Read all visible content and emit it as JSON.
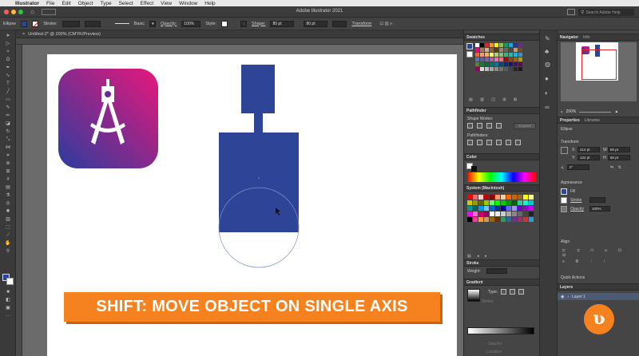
{
  "menubar": {
    "apple": "",
    "app": "Illustrator",
    "items": [
      "File",
      "Edit",
      "Object",
      "Type",
      "Select",
      "Effect",
      "View",
      "Window",
      "Help"
    ]
  },
  "titlebar": {
    "title": "Adobe Illustrator 2021",
    "search_placeholder": "Search Adobe Help"
  },
  "controlbar": {
    "selection": "Ellipse",
    "stroke_label": "Stroke:",
    "brush": "Basic",
    "opacity_label": "Opacity:",
    "opacity_value": "100%",
    "style_label": "Style:",
    "shape_label": "Shape:",
    "w_value": "80 pt",
    "h_value": "80 pt",
    "transform_label": "Transform"
  },
  "document": {
    "tab": "Untitled-2* @ 200% (CMYK/Preview)"
  },
  "swatches": {
    "title": "Swatches",
    "colors": [
      "#ffffff",
      "#000000",
      "#ed1c24",
      "#f7941d",
      "#fff200",
      "#8dc63f",
      "#00a651",
      "#00aeef",
      "#2e3192",
      "#662d91",
      "#ec008c",
      "#a67c52",
      "#c2b59b",
      "#8c6239",
      "#603913",
      "#998675",
      "#736357",
      "#534741",
      "#c69c6d",
      "#754c24",
      "#f26522",
      "#f7977a",
      "#fbaf5d",
      "#fff568",
      "#acd373",
      "#7cc576",
      "#3bb878",
      "#1abbb4",
      "#00bff3",
      "#438ccb",
      "#5674b9",
      "#605ca8",
      "#8560a8",
      "#a864a8",
      "#f06eaa",
      "#f26d7d",
      "#9e0b0f",
      "#a0410d",
      "#a3620a",
      "#aba000",
      "#598527",
      "#197b30",
      "#007236",
      "#00746b",
      "#0076a3",
      "#004a80",
      "#003471",
      "#1b1464",
      "#440e62",
      "#630460",
      "#9e005d",
      "#d9d9d9",
      "#bfbfbf",
      "#a6a6a6",
      "#8c8c8c",
      "#737373",
      "#595959",
      "#404040",
      "#262626",
      "#1a1a1a"
    ]
  },
  "pathfinder": {
    "title": "Pathfinder",
    "shape_modes": "Shape Modes:",
    "expand": "Expand",
    "pathfinders": "Pathfinders:"
  },
  "color": {
    "title": "Color"
  },
  "system_swatches": {
    "title": "System (Macintosh)",
    "colors": [
      "#ff0000",
      "#ff6666",
      "#ffcccc",
      "#cc0000",
      "#990000",
      "#ff9966",
      "#ffcc99",
      "#ff6600",
      "#cc6600",
      "#996633",
      "#ffff00",
      "#ffff99",
      "#cccc00",
      "#999900",
      "#666600",
      "#99cc00",
      "#66ff66",
      "#00ff00",
      "#00cc00",
      "#009900",
      "#006600",
      "#33cc99",
      "#00ffcc",
      "#00cccc",
      "#009999",
      "#006666",
      "#0099ff",
      "#66ccff",
      "#0066cc",
      "#003399",
      "#000099",
      "#6666ff",
      "#9999ff",
      "#6600cc",
      "#9900cc",
      "#cc00ff",
      "#ff00ff",
      "#ff66cc",
      "#cc0066",
      "#990066",
      "#ffffff",
      "#eeeeee",
      "#cccccc",
      "#aaaaaa",
      "#888888",
      "#666666",
      "#444444",
      "#222222",
      "#000000",
      "#ff3399",
      "#ff9933",
      "#cc9966",
      "#996600",
      "#663300",
      "#339966",
      "#336699",
      "#663399",
      "#993366",
      "#cc3333",
      "#3399cc"
    ]
  },
  "stroke": {
    "title": "Stroke",
    "weight_label": "Weight:"
  },
  "gradient": {
    "title": "Gradient",
    "type_label": "Type:",
    "stroke_label": "Stroke:",
    "opacity_label": "Opacity:",
    "location_label": "Location:"
  },
  "navigator": {
    "tab1": "Navigator",
    "tab2": "Info",
    "zoom": "200%"
  },
  "properties": {
    "tab1": "Properties",
    "tab2": "Libraries",
    "object": "Ellipse",
    "transform_title": "Transform",
    "x_label": "X:",
    "x_value": "212 pt",
    "y_label": "Y:",
    "y_value": "122 pt",
    "w_label": "W:",
    "w_value": "80 pt",
    "h_label": "H:",
    "h_value": "80 pt",
    "angle_value": "0°",
    "appearance_title": "Appearance",
    "fill_label": "Fill",
    "stroke_label": "Stroke",
    "opacity_label": "Opacity",
    "opacity_value": "100%",
    "align_title": "Align",
    "quick_actions": "Quick Actions"
  },
  "layers": {
    "title": "Layers",
    "layer_name": "Layer 1"
  },
  "banner": {
    "text": "SHIFT: MOVE OBJECT ON SINGLE AXIS"
  },
  "logo": {
    "glyph": "ʋ"
  },
  "colors": {
    "artwork_blue": "#2e4597",
    "banner_orange": "#f6821f",
    "icon_gradient_start": "#e8177b",
    "icon_gradient_end": "#2c3c9e"
  }
}
